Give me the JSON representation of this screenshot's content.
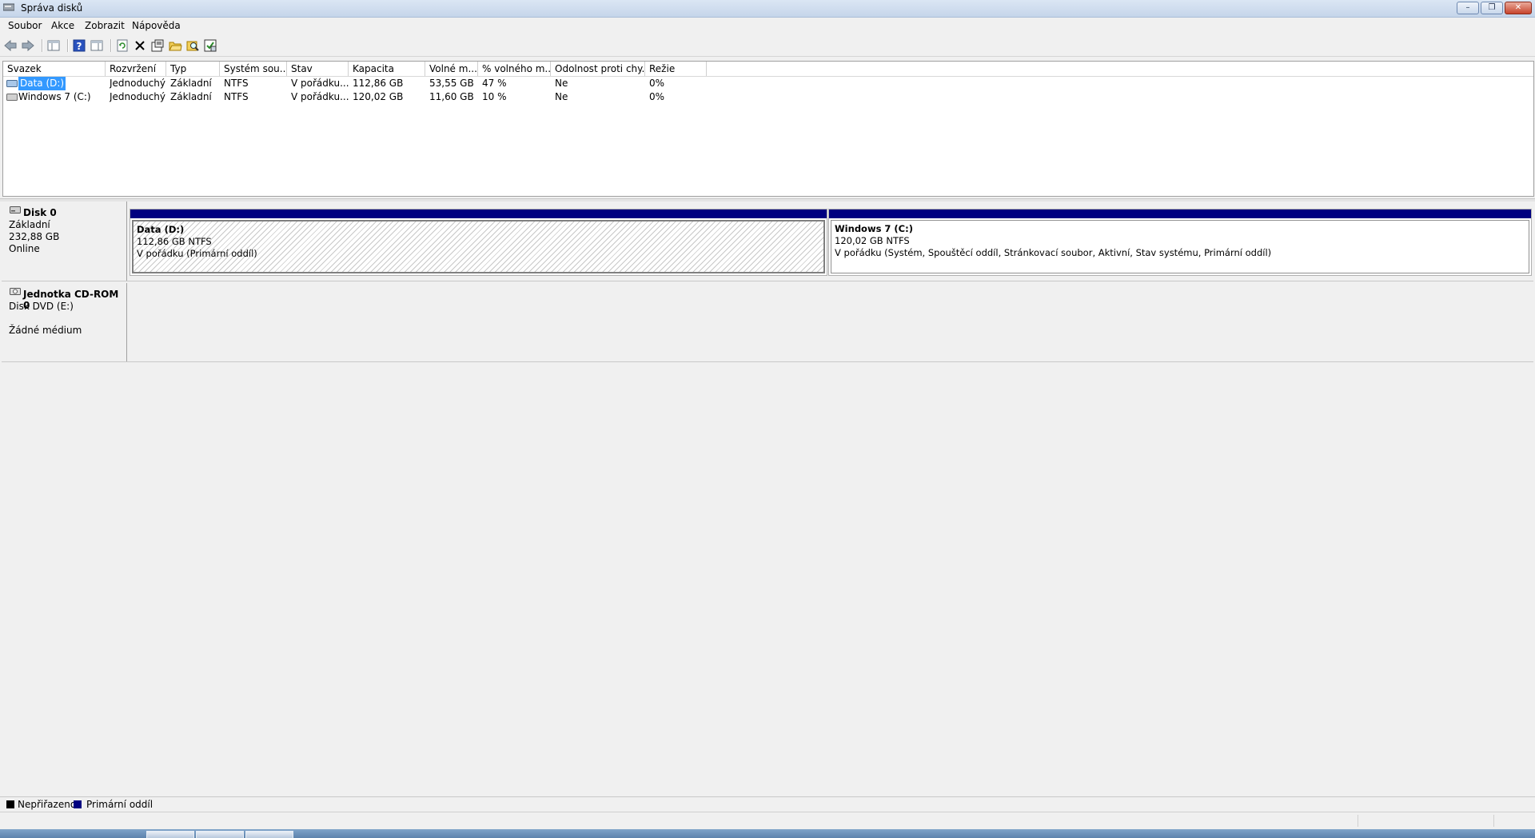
{
  "window": {
    "title": "Správa disků"
  },
  "menu": [
    {
      "label": "Soubor"
    },
    {
      "label": "Akce"
    },
    {
      "label": "Zobrazit"
    },
    {
      "label": "Nápověda"
    }
  ],
  "toolbar": {
    "buttons": [
      "back-icon",
      "forward-icon",
      "console-tree-icon",
      "help-icon",
      "show-hide-icon",
      "refresh-icon",
      "delete-icon",
      "properties-icon",
      "open-icon",
      "explore-icon",
      "settings-icon"
    ]
  },
  "volume_list": {
    "columns": [
      "Svazek",
      "Rozvržení",
      "Typ",
      "Systém sou...",
      "Stav",
      "Kapacita",
      "Volné m...",
      "% volného m...",
      "Odolnost proti chy...",
      "Režie"
    ],
    "rows": [
      {
        "name": "Data (D:)",
        "layout": "Jednoduchý",
        "type": "Základní",
        "fs": "NTFS",
        "status": "V pořádku...",
        "capacity": "112,86 GB",
        "free": "53,55 GB",
        "pct_free": "47 %",
        "fault": "Ne",
        "overhead": "0%"
      },
      {
        "name": "Windows 7 (C:)",
        "layout": "Jednoduchý",
        "type": "Základní",
        "fs": "NTFS",
        "status": "V pořádku...",
        "capacity": "120,02 GB",
        "free": "11,60 GB",
        "pct_free": "10 %",
        "fault": "Ne",
        "overhead": "0%"
      }
    ]
  },
  "disks": [
    {
      "name": "Disk 0",
      "type": "Základní",
      "size": "232,88 GB",
      "state": "Online",
      "partitions": [
        {
          "title": "Data  (D:)",
          "size": "112,86 GB NTFS",
          "status": "V pořádku (Primární oddíl)"
        },
        {
          "title": "Windows 7  (C:)",
          "size": "120,02 GB NTFS",
          "status": "V pořádku (Systém, Spouštěcí oddíl, Stránkovací soubor, Aktivní, Stav systému, Primární oddíl)"
        }
      ]
    },
    {
      "name": "Jednotka CD-ROM 0",
      "type": "Disk DVD (E:)",
      "state": "Žádné médium"
    }
  ],
  "legend": [
    {
      "label": "Nepřiřazeno",
      "color": "#000000"
    },
    {
      "label": "Primární oddíl",
      "color": "#000080"
    }
  ]
}
